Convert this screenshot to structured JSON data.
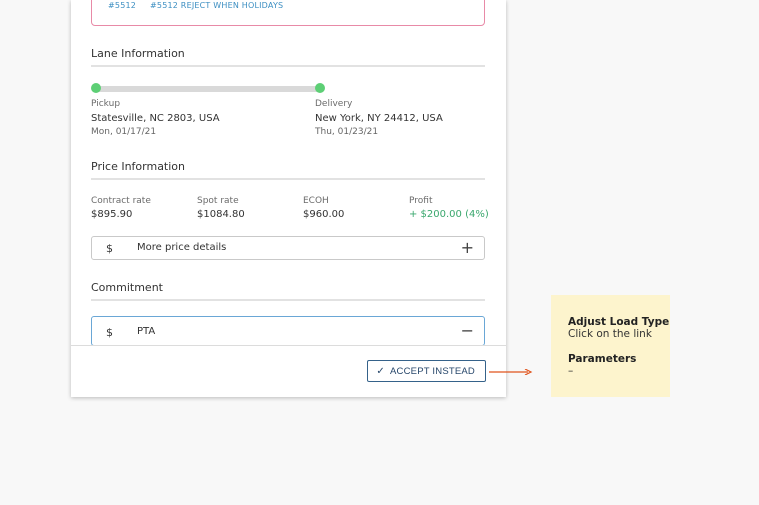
{
  "top_refs": [
    "#5512",
    "#5512 REJECT WHEN HOLIDAYS"
  ],
  "lane": {
    "title": "Lane Information",
    "pickup": {
      "label": "Pickup",
      "location": "Statesville, NC 2803, USA",
      "date": "Mon, 01/17/21"
    },
    "delivery": {
      "label": "Delivery",
      "location": "New York, NY 24412, USA",
      "date": "Thu, 01/23/21"
    }
  },
  "price": {
    "title": "Price Information",
    "items": [
      {
        "label": "Contract rate",
        "value": "$895.90"
      },
      {
        "label": "Spot rate",
        "value": "$1084.80"
      },
      {
        "label": "ECOH",
        "value": "$960.00"
      },
      {
        "label": "Profit",
        "value": "+ $200.00 (4%)"
      }
    ],
    "more_details": {
      "symbol": "$",
      "label": "More price details",
      "sign": "+"
    }
  },
  "commitment": {
    "title": "Commitment",
    "pta": {
      "symbol": "$",
      "label": "PTA",
      "sign": "−"
    }
  },
  "footer": {
    "accept_label": "ACCEPT INSTEAD",
    "check": "✓"
  },
  "note": {
    "title1": "Adjust Load Type",
    "desc1": "Click on the link",
    "title2": "Parameters",
    "desc2": "–"
  },
  "colors": {
    "accent": "#35628a",
    "green": "#5dcf75",
    "profit": "#3aa76d",
    "arrow": "#e0531c",
    "note_bg": "#fdf4cd"
  }
}
